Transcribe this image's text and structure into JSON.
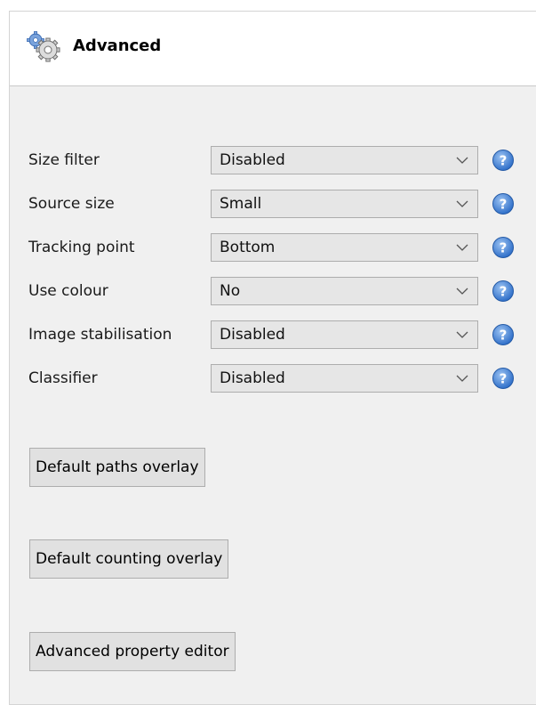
{
  "panel": {
    "title": "Advanced",
    "header_icon": "gears-icon"
  },
  "settings": [
    {
      "label": "Size filter",
      "value": "Disabled"
    },
    {
      "label": "Source size",
      "value": "Small"
    },
    {
      "label": "Tracking point",
      "value": "Bottom"
    },
    {
      "label": "Use colour",
      "value": "No"
    },
    {
      "label": "Image stabilisation",
      "value": "Disabled"
    },
    {
      "label": "Classifier",
      "value": "Disabled"
    }
  ],
  "buttons": {
    "default_paths": "Default paths overlay",
    "default_counting": "Default counting overlay",
    "advanced_editor": "Advanced property editor"
  },
  "colors": {
    "panel_bg": "#f0f0f0",
    "select_bg": "#e6e6e6",
    "help_blue": "#3b7fd6"
  }
}
